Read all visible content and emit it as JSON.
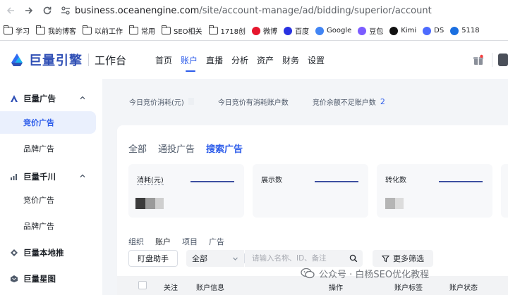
{
  "browser": {
    "url_host": "business.oceanengine.com",
    "url_path": "/site/account-manage/ad/bidding/superior/account",
    "bookmarks": [
      {
        "label": "学习",
        "icon": "folder-icon"
      },
      {
        "label": "我的博客",
        "icon": "folder-icon"
      },
      {
        "label": "以前工作",
        "icon": "folder-icon"
      },
      {
        "label": "常用",
        "icon": "folder-icon"
      },
      {
        "label": "SEO相关",
        "icon": "folder-icon"
      },
      {
        "label": "1718创",
        "icon": "folder-icon"
      },
      {
        "label": "微博",
        "icon": "weibo-icon"
      },
      {
        "label": "百度",
        "icon": "baidu-icon"
      },
      {
        "label": "Google",
        "icon": "google-icon"
      },
      {
        "label": "豆包",
        "icon": "doubao-icon"
      },
      {
        "label": "Kimi",
        "icon": "kimi-icon"
      },
      {
        "label": "DS",
        "icon": "deepseek-icon"
      },
      {
        "label": "5118",
        "icon": "5118-icon"
      }
    ]
  },
  "header": {
    "logo_text": "巨量引擎",
    "workbench": "工作台",
    "nav": [
      "首页",
      "账户",
      "直播",
      "分析",
      "资产",
      "财务",
      "设置"
    ],
    "active_nav": 1
  },
  "sidebar": {
    "groups": [
      {
        "label": "巨量广告",
        "icon": "oceanengine-ad-icon",
        "expanded": true,
        "children": [
          "竞价广告",
          "品牌广告"
        ]
      },
      {
        "label": "巨量千川",
        "icon": "qianchuan-icon",
        "expanded": true,
        "children": [
          "竞价广告",
          "品牌广告"
        ]
      },
      {
        "label": "巨量本地推",
        "icon": "local-push-icon"
      },
      {
        "label": "巨量星图",
        "icon": "star-map-icon"
      }
    ],
    "active_item": "竞价广告"
  },
  "stats": {
    "items": [
      {
        "label": "今日竞价消耗(元)",
        "value": ""
      },
      {
        "label": "今日竞价有消耗账户数",
        "value": ""
      },
      {
        "label": "竞价余额不足账户数",
        "value": "2"
      }
    ]
  },
  "main_tabs": {
    "items": [
      "全部",
      "通投广告",
      "搜索广告"
    ],
    "active": 2
  },
  "metrics": [
    {
      "label": "消耗(元)"
    },
    {
      "label": "展示数"
    },
    {
      "label": "转化数"
    }
  ],
  "sub_tabs": {
    "items": [
      "组织",
      "账户",
      "项目",
      "广告"
    ],
    "active": 1
  },
  "toolbar": {
    "monitor_button": "盯盘助手",
    "select_value": "全部",
    "search_placeholder": "请输入名称、ID、备注",
    "filter_button": "更多筛选"
  },
  "table": {
    "columns": [
      "关注",
      "账户信息",
      "操作",
      "账户标签",
      "账户状态"
    ]
  },
  "watermark": "公众号 · 白杨SEO优化教程",
  "colors": {
    "accent": "#2b5bea",
    "logo": "#2f4fb5"
  }
}
